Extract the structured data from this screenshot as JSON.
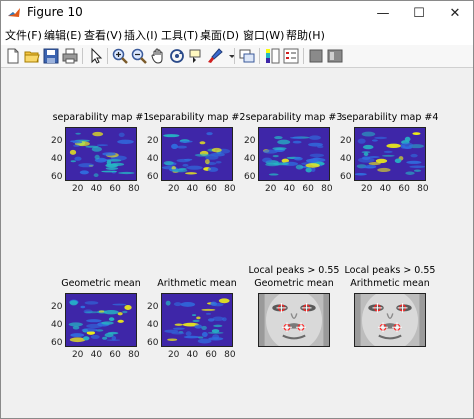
{
  "window": {
    "title": "Figure 10",
    "minimize_glyph": "—",
    "maximize_glyph": "☐",
    "close_glyph": "✕"
  },
  "menu": [
    {
      "label": "文件(F)"
    },
    {
      "label": "编辑(E)"
    },
    {
      "label": "查看(V)"
    },
    {
      "label": "插入(I)"
    },
    {
      "label": "工具(T)"
    },
    {
      "label": "桌面(D)"
    },
    {
      "label": "窗口(W)"
    },
    {
      "label": "帮助(H)"
    }
  ],
  "toolbar": {
    "icons": [
      "new-figure-icon",
      "open-file-icon",
      "save-icon",
      "print-icon",
      "pointer-icon",
      "zoom-in-icon",
      "zoom-out-icon",
      "pan-icon",
      "rotate-3d-icon",
      "data-cursor-icon",
      "brush-icon",
      "link-plot-icon",
      "insert-colorbar-icon",
      "insert-legend-icon",
      "hide-plot-tools-icon",
      "show-plot-tools-icon"
    ]
  },
  "colors": {
    "colormap_low": "#3e26a8",
    "colormap_mid": "#25b8c4",
    "colormap_high": "#f9fb0e",
    "marker": "#ff2020"
  },
  "panels_top": [
    {
      "title": "separability map #1"
    },
    {
      "title": "separability map #2"
    },
    {
      "title": "separability map #3"
    },
    {
      "title": "separability map #4"
    }
  ],
  "panels_bottom": [
    {
      "title": "Geometric mean",
      "title2": ""
    },
    {
      "title": "Arithmetic mean",
      "title2": ""
    },
    {
      "title": "Local peaks > 0.55",
      "title2": "Geometric mean"
    },
    {
      "title": "Local peaks > 0.55",
      "title2": "Arithmetic mean"
    }
  ],
  "axis": {
    "y_ticks": [
      "20",
      "40",
      "60"
    ],
    "x_ticks": [
      "20",
      "40",
      "60",
      "80"
    ]
  }
}
